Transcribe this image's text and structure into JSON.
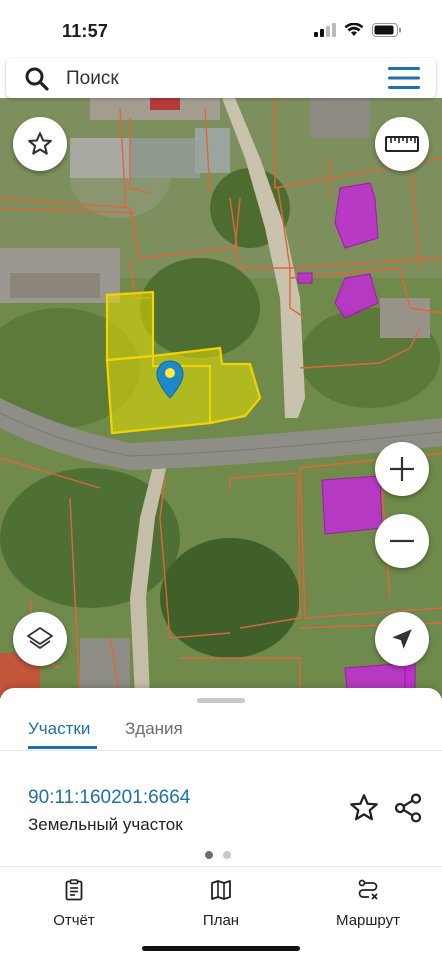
{
  "status_bar": {
    "time": "11:57"
  },
  "search": {
    "placeholder": "Поиск"
  },
  "sheet": {
    "tabs": [
      {
        "label": "Участки",
        "active": true
      },
      {
        "label": "Здания",
        "active": false
      }
    ],
    "parcel": {
      "number": "90:11:160201:6664",
      "type": "Земельный участок"
    },
    "pager": {
      "count": 2,
      "active": 1
    }
  },
  "bottom_nav": [
    {
      "label": "Отчёт",
      "icon": "report-icon"
    },
    {
      "label": "План",
      "icon": "map-plan-icon"
    },
    {
      "label": "Маршрут",
      "icon": "route-icon"
    }
  ],
  "map": {
    "controls": [
      "favorite-icon",
      "ruler-icon",
      "layers-icon",
      "zoom-in-icon",
      "zoom-out-icon",
      "location-arrow-icon"
    ]
  },
  "colors": {
    "accent": "#1e6fb0",
    "parcel_fill": "#e8e000",
    "parcel_border": "#f3d400",
    "building_fill": "#c22cd6",
    "boundary": "#e0663a"
  }
}
